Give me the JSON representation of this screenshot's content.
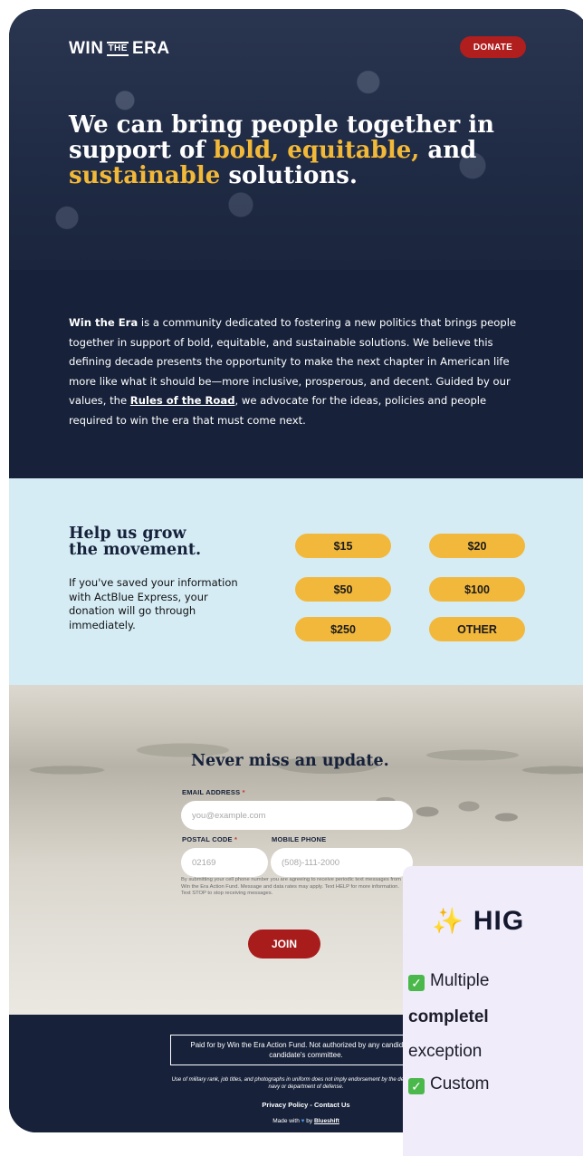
{
  "header": {
    "logo": {
      "part1": "WIN",
      "part2": "THE",
      "part3": "ERA"
    },
    "donate_label": "DONATE"
  },
  "hero": {
    "line1": "We can bring people together in",
    "line2_a": "support of ",
    "line2_b": "bold, equitable,",
    "line2_c": " and",
    "line3_a": "sustainable",
    "line3_b": " solutions.",
    "highlight_color": "#f2b838"
  },
  "intro": {
    "brand": "Win the Era",
    "text1": " is a community dedicated to fostering a new politics that brings people together in support of bold, equitable, and sustainable solutions. We believe this defining decade presents the opportunity to make the next chapter in American life more like what it should be—more inclusive, prosperous, and decent. Guided by our values, the ",
    "link": "Rules of the Road",
    "text2": ", we advocate for the ideas, policies and people required to win the era that must come next."
  },
  "donate": {
    "title_line1": "Help us grow",
    "title_line2": "the movement.",
    "text": "If you've saved your information with ActBlue Express, your donation will go through immediately.",
    "amounts": [
      "$15",
      "$20",
      "$50",
      "$100",
      "$250",
      "OTHER"
    ]
  },
  "signup": {
    "title": "Never miss an update.",
    "email_label": "EMAIL ADDRESS",
    "email_placeholder": "you@example.com",
    "postal_label": "POSTAL CODE",
    "postal_placeholder": "02169",
    "mobile_label": "MOBILE PHONE",
    "mobile_placeholder": "(508)-111-2000",
    "required_mark": "*",
    "disclaimer": "By submitting your cell phone number you are agreeing to receive periodic text messages from Win the Era Action Fund. Message and data rates may apply. Text HELP for more information. Text STOP to stop receiving messages.",
    "join_label": "JOIN"
  },
  "footer": {
    "paid_for": "Paid for by Win the Era Action Fund. Not authorized by any candidate or candidate's committee.",
    "military": "Use of military rank, job titles, and photographs in uniform does not imply endorsement by the department of the navy or department of defense.",
    "privacy": "Privacy Policy",
    "separator": " - ",
    "contact": "Contact Us",
    "made_with": "Made with",
    "heart": "♥",
    "by": " by ",
    "credit": "Blueshift"
  },
  "overlay": {
    "spark": "✨",
    "title": "HIG",
    "check": "✓",
    "line1": "Multiple",
    "line2": "completel",
    "line3": "exception",
    "line4": "Custom"
  }
}
